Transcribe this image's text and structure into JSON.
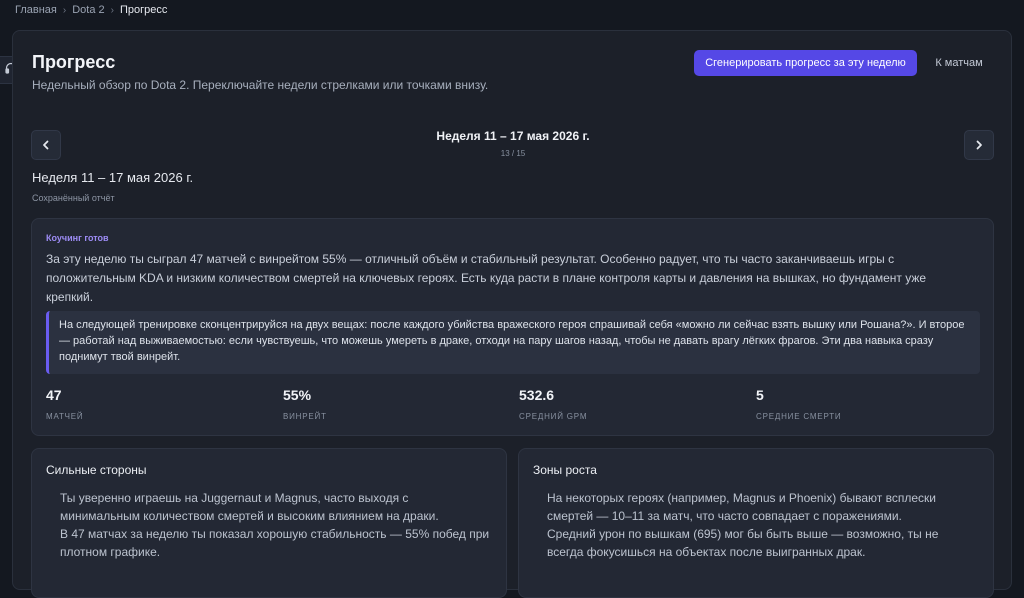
{
  "breadcrumb": {
    "items": [
      "Главная",
      "Dota 2"
    ],
    "current": "Прогресс",
    "separator": "›"
  },
  "header": {
    "title": "Прогресс",
    "subtitle": "Недельный обзор по Dota 2. Переключайте недели стрелками или точками внизу.",
    "generate_button": "Сгенерировать прогресс за эту неделю",
    "matches_link": "К матчам"
  },
  "week_nav": {
    "title": "Неделя 11 – 17 мая 2026 г.",
    "page": "13 / 15",
    "prev_glyph": "‹",
    "next_glyph": "›"
  },
  "report": {
    "week_label": "Неделя 11 – 17 мая 2026 г.",
    "status": "Сохранённый отчёт"
  },
  "coaching": {
    "tag": "Коучинг готов",
    "summary": "За эту неделю ты сыграл 47 матчей с винрейтом 55% — отличный объём и стабильный результат. Особенно радует, что ты часто заканчиваешь игры с положительным KDA и низким количеством смертей на ключевых героях. Есть куда расти в плане контроля карты и давления на вышках, но фундамент уже крепкий.",
    "advice": "На следующей тренировке сконцентрируйся на двух вещах: после каждого убийства вражеского героя спрашивай себя «можно ли сейчас взять вышку или Рошана?». И второе — работай над выживаемостью: если чувствуешь, что можешь умереть в драке, отходи на пару шагов назад, чтобы не давать врагу лёгких фрагов. Эти два навыка сразу поднимут твой винрейт.",
    "stats": [
      {
        "value": "47",
        "label": "МАТЧЕЙ"
      },
      {
        "value": "55%",
        "label": "ВИНРЕЙТ"
      },
      {
        "value": "532.6",
        "label": "СРЕДНИЙ GPM"
      },
      {
        "value": "5",
        "label": "СРЕДНИЕ СМЕРТИ"
      }
    ]
  },
  "strengths": {
    "title": "Сильные стороны",
    "items": [
      "Ты уверенно играешь на Juggernaut и Magnus, часто выходя с минимальным количеством смертей и высоким влиянием на драки.",
      "В 47 матчах за неделю ты показал хорошую стабильность — 55% побед при плотном графике."
    ]
  },
  "growth": {
    "title": "Зоны роста",
    "items": [
      "На некоторых героях (например, Magnus и Phoenix) бывают всплески смертей — 10–11 за матч, что часто совпадает с поражениями.",
      "Средний урон по вышкам (695) мог бы быть выше — возможно, ты не всегда фокусишься на объектах после выигранных драк."
    ]
  },
  "colors": {
    "accent": "#5548e6",
    "quote_border": "#6a5cf0",
    "tag": "#9d8cf5"
  }
}
